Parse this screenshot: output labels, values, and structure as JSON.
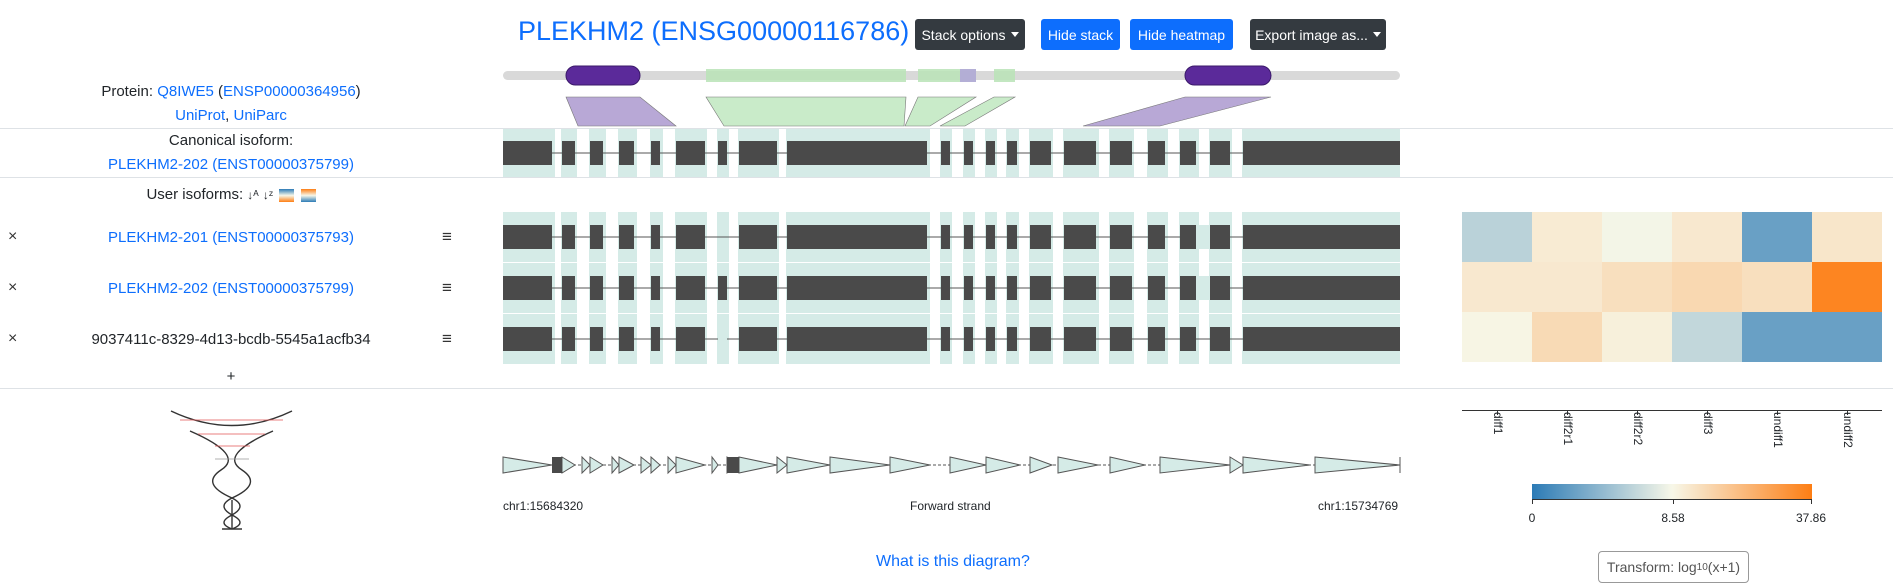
{
  "header": {
    "title": "PLEKHM2 (ENSG00000116786)",
    "stack_options_label": "Stack options",
    "hide_stack_label": "Hide stack",
    "hide_heatmap_label": "Hide heatmap",
    "export_label": "Export image as..."
  },
  "protein": {
    "label": "Protein:",
    "uniprot_id": "Q8IWE5",
    "ensp_id": "ENSP00000364956",
    "link_uniprot": "UniProt",
    "link_uniparc": "UniParc"
  },
  "canonical": {
    "label": "Canonical isoform:",
    "name": "PLEKHM2-202 (ENST00000375799)"
  },
  "user_isoforms": {
    "label": "User isoforms:",
    "rows": [
      {
        "name": "PLEKHM2-201 (ENST00000375793)",
        "is_link": true
      },
      {
        "name": "PLEKHM2-202 (ENST00000375799)",
        "is_link": true
      },
      {
        "name": "9037411c-8329-4d13-bcdb-5545a1acfb34",
        "is_link": false
      }
    ],
    "remove_symbol": "×",
    "menu_symbol": "≡",
    "add_symbol": "+"
  },
  "genome": {
    "start_coord": "chr1:15684320",
    "strand": "Forward strand",
    "end_coord": "chr1:15734769"
  },
  "heatmap": {
    "columns": [
      "diff1",
      "diff2r1",
      "diff2r2",
      "diff3",
      "undiff1",
      "undiff2"
    ],
    "values": [
      [
        0.35,
        0.55,
        0.49,
        0.56,
        0.15,
        0.57
      ],
      [
        0.56,
        0.56,
        0.6,
        0.63,
        0.6,
        0.97
      ],
      [
        0.51,
        0.62,
        0.53,
        0.37,
        0.15,
        0.15
      ]
    ],
    "scale_ticks": [
      "0",
      "8.58",
      "37.86"
    ],
    "colors": {
      "low": "#2c7bb6",
      "mid": "#f7f7e8",
      "high": "#fd7e14"
    }
  },
  "footer": {
    "help_link": "What is this diagram?",
    "transform_label": "Transform: log",
    "transform_sub": "10",
    "transform_suffix": "(x+1)"
  },
  "colors": {
    "accent": "#0d6efd",
    "exon": "#4a4a4a",
    "exon_bg": "#d5ebe7",
    "domain": "#5b2a9a",
    "region": "#b8e3b6"
  }
}
